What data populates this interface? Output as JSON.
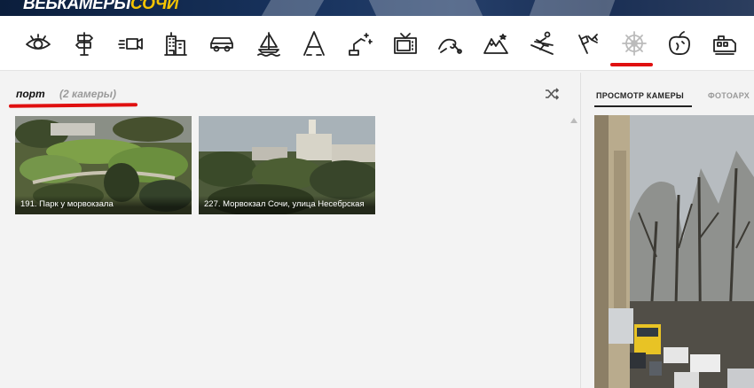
{
  "site": {
    "logo_part1": "ВЕБКАМЕРЫ",
    "logo_part2": "СОЧИ",
    "accent_color": "#f5c400",
    "banner_color": "#0b1e3c"
  },
  "category_icons": [
    {
      "name": "eye-icon",
      "active": false
    },
    {
      "name": "signpost-icon",
      "active": false
    },
    {
      "name": "video-camera-icon",
      "active": false
    },
    {
      "name": "building-icon",
      "active": false
    },
    {
      "name": "car-icon",
      "active": false
    },
    {
      "name": "sailboat-icon",
      "active": false
    },
    {
      "name": "letter-a-icon",
      "active": false
    },
    {
      "name": "drone-icon",
      "active": false
    },
    {
      "name": "tv-icon",
      "active": false
    },
    {
      "name": "wave-icon",
      "active": false
    },
    {
      "name": "mountains-icon",
      "active": false
    },
    {
      "name": "skier-icon",
      "active": false
    },
    {
      "name": "flag-icon",
      "active": false
    },
    {
      "name": "ship-wheel-icon",
      "active": true
    },
    {
      "name": "fruit-icon",
      "active": false
    },
    {
      "name": "train-icon",
      "active": false
    }
  ],
  "category": {
    "title": "порт",
    "count": "(2 камеры)"
  },
  "cameras": [
    {
      "caption": "191. Парк у морвокзала"
    },
    {
      "caption": "227. Морвокзал Сочи, улица Несебрская"
    }
  ],
  "right_panel": {
    "tab_view": "ПРОСМОТР КАМЕРЫ",
    "tab_archive": "ФОТОАРХ"
  },
  "annotation_color": "#e01010"
}
